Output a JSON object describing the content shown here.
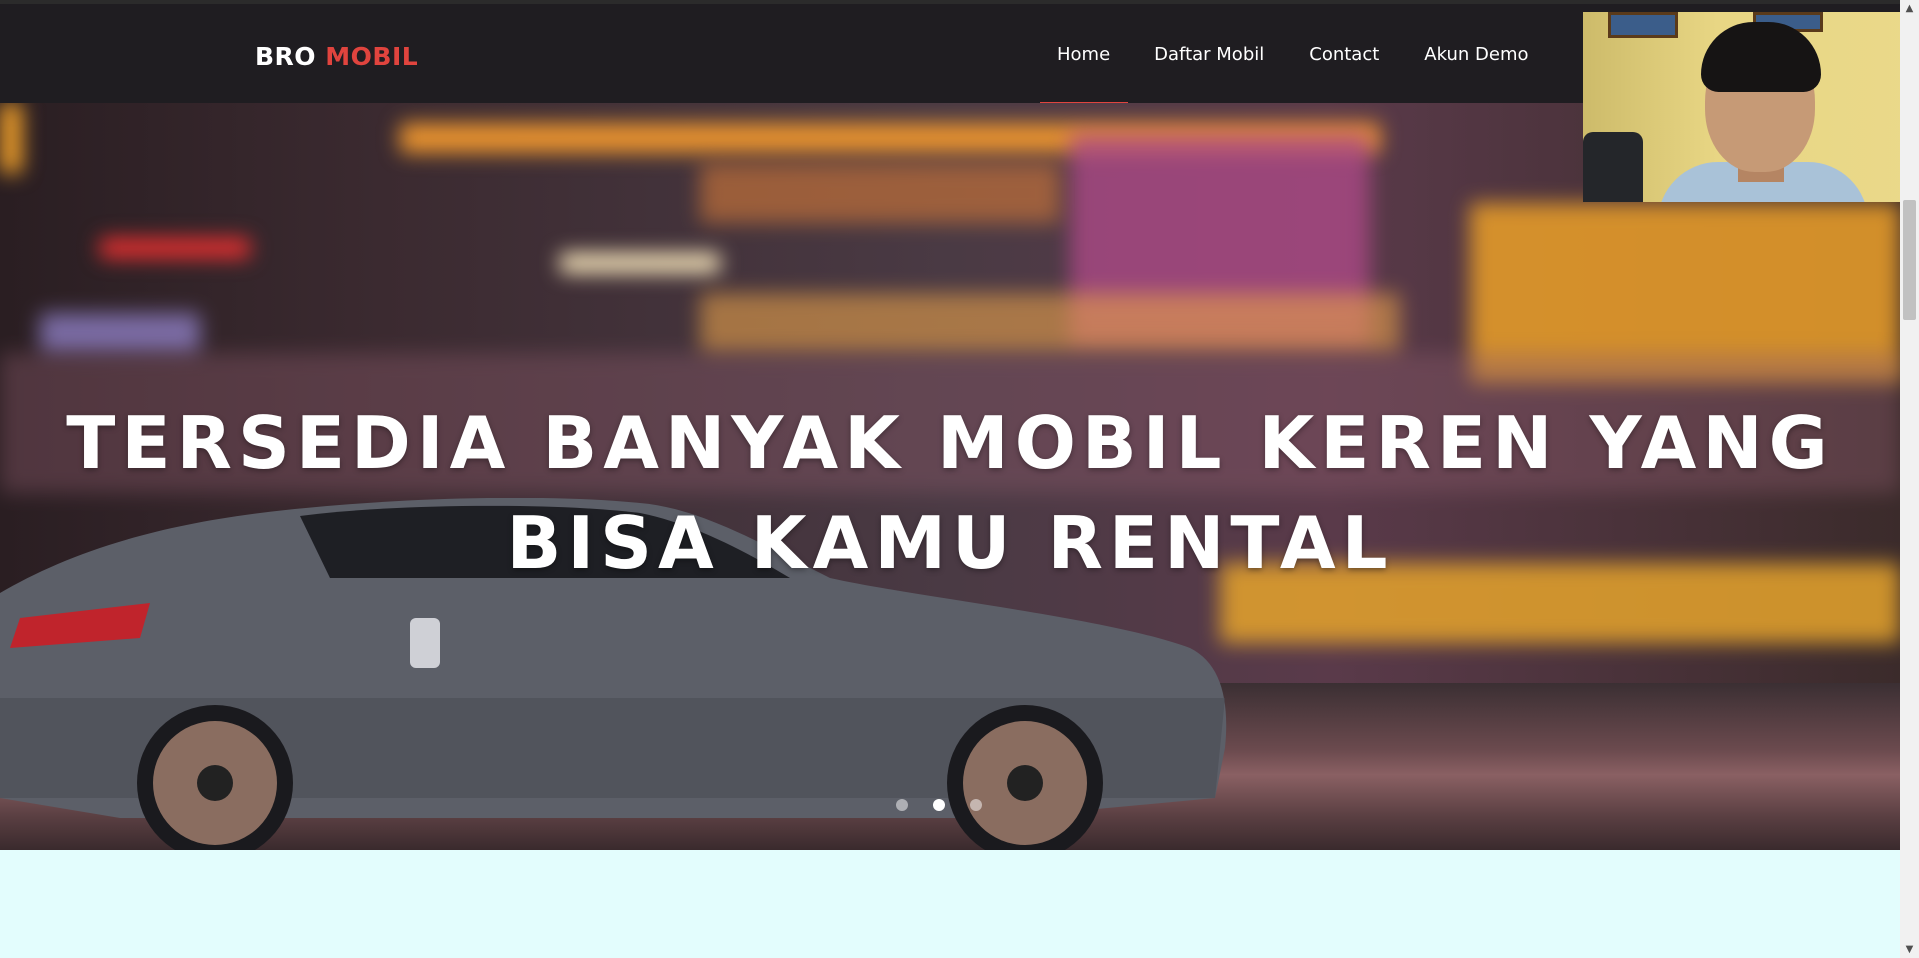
{
  "brand": {
    "part1": "BRO",
    "part2": "MOBIL"
  },
  "nav": {
    "items": [
      {
        "label": "Home",
        "active": true
      },
      {
        "label": "Daftar Mobil",
        "active": false
      },
      {
        "label": "Contact",
        "active": false
      },
      {
        "label": "Akun Demo",
        "active": false
      }
    ]
  },
  "hero": {
    "title": "TERSEDIA BANYAK MOBIL KEREN YANG BISA KAMU RENTAL",
    "slides": 3,
    "active_slide": 2
  },
  "colors": {
    "nav_bg": "#1f1d21",
    "accent": "#e0443e",
    "page_bg": "#e3fdfd"
  }
}
